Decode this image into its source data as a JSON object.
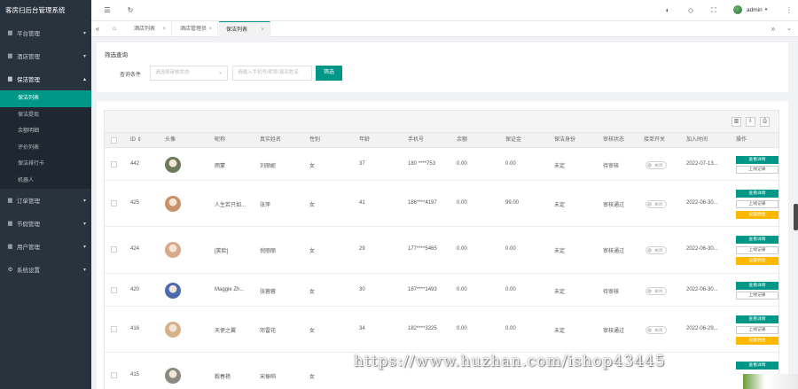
{
  "app": {
    "title": "客房扫后台管理系统"
  },
  "sidebar": {
    "items": [
      {
        "label": "平台管理",
        "icon": "grid-icon",
        "caret": "▾"
      },
      {
        "label": "酒店管理",
        "icon": "grid-icon",
        "caret": "▾"
      },
      {
        "label": "保洁管理",
        "icon": "grid-icon",
        "caret": "▴"
      },
      {
        "label": "订单管理",
        "icon": "grid-icon",
        "caret": "▾"
      },
      {
        "label": "节假管理",
        "icon": "grid-icon",
        "caret": "▾"
      },
      {
        "label": "用户管理",
        "icon": "grid-icon",
        "caret": "▾"
      },
      {
        "label": "系统设置",
        "icon": "gear-icon",
        "caret": "▾"
      }
    ],
    "submenu": [
      "保洁列表",
      "保洁提现",
      "余额明细",
      "评价列表",
      "保洁排行卡",
      "机器人"
    ]
  },
  "header": {
    "user": "admin",
    "user_caret": "▾"
  },
  "tabs": [
    {
      "label": "酒店列表",
      "close": "×"
    },
    {
      "label": "酒店管理员",
      "close": "×"
    },
    {
      "label": "保洁列表",
      "close": "×"
    }
  ],
  "filter": {
    "title": "筛选查询",
    "condition_label": "查询条件",
    "select_placeholder": "请选择审核状态",
    "input_placeholder": "请输入手机号/昵称/真实姓名",
    "button": "筛选"
  },
  "table": {
    "columns": [
      "ID",
      "头像",
      "昵称",
      "真实姓名",
      "性别",
      "年龄",
      "手机号",
      "余额",
      "保证金",
      "保洁身份",
      "审核状态",
      "接单开关",
      "加入时间",
      "操作"
    ],
    "actions": {
      "detail": "查看详情",
      "record": "上线记录",
      "commission": "设置佣金"
    },
    "toggle_label": "关闭",
    "rows": [
      {
        "id": "442",
        "nickname": "雨蒙",
        "real_name": "刘丽妮",
        "gender": "女",
        "age": "37",
        "phone": "180 ****753",
        "balance": "0.00",
        "deposit": "0.00",
        "identity": "未定",
        "status": "待审核",
        "joined": "2022-07-13...",
        "avatar_color": "#6b7a5a"
      },
      {
        "id": "425",
        "nickname": "人生若只如...",
        "real_name": "张萍",
        "gender": "女",
        "age": "41",
        "phone": "186****4197",
        "balance": "0.00",
        "deposit": "99.00",
        "identity": "未定",
        "status": "审核通过",
        "joined": "2022-06-30...",
        "avatar_color": "#c9926a"
      },
      {
        "id": "424",
        "nickname": "[笑脸]",
        "real_name": "倪丽丽",
        "gender": "女",
        "age": "29",
        "phone": "177****5465",
        "balance": "0.00",
        "deposit": "0.00",
        "identity": "未定",
        "status": "审核通过",
        "joined": "2022-06-30...",
        "avatar_color": "#d9a98c"
      },
      {
        "id": "420",
        "nickname": "Maggie Zh...",
        "real_name": "张蓉蓉",
        "gender": "女",
        "age": "30",
        "phone": "187****1493",
        "balance": "0.00",
        "deposit": "0.00",
        "identity": "未定",
        "status": "待审核",
        "joined": "2022-06-30...",
        "avatar_color": "#4d6ab0"
      },
      {
        "id": "416",
        "nickname": "天使之翼",
        "real_name": "邓雷花",
        "gender": "女",
        "age": "34",
        "phone": "182****3225",
        "balance": "0.00",
        "deposit": "0.00",
        "identity": "未定",
        "status": "审核通过",
        "joined": "2022-06-29...",
        "avatar_color": "#d5b18a"
      },
      {
        "id": "415",
        "nickname": "毅春艳",
        "real_name": "宋振响",
        "gender": "女",
        "age": "",
        "phone": "",
        "balance": "",
        "deposit": "",
        "identity": "",
        "status": "",
        "joined": "",
        "avatar_color": "#8a8a80"
      }
    ]
  },
  "watermark": "https://www.huzhan.com/ishop43445"
}
